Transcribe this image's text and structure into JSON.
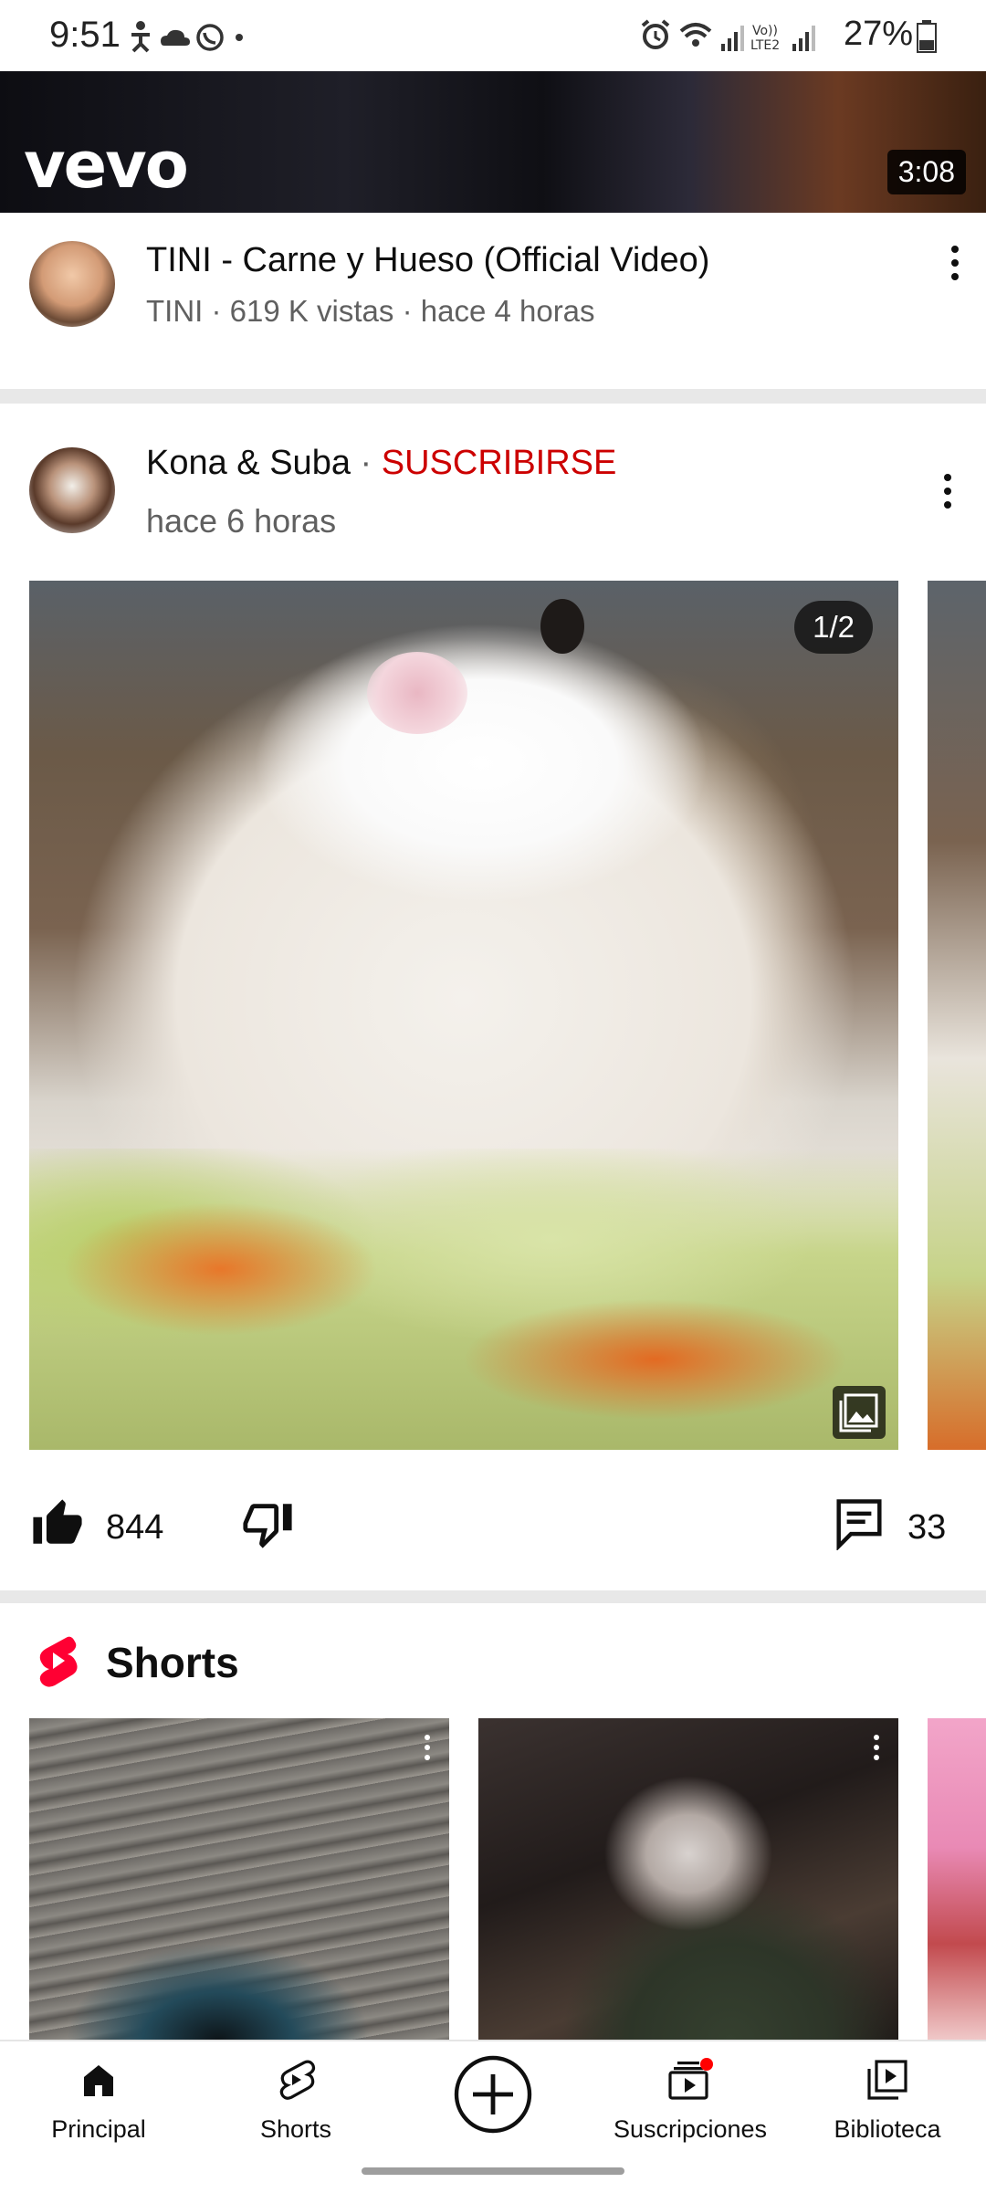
{
  "status_bar": {
    "time": "9:51",
    "battery": "27%",
    "icons": [
      "accessibility-icon",
      "cloud-icon",
      "whatsapp-icon",
      "dot-icon",
      "alarm-icon",
      "wifi-icon",
      "signal-icon",
      "volte-icon",
      "signal-icon",
      "battery-icon"
    ]
  },
  "video_card": {
    "brand": "vevo",
    "duration": "3:08",
    "title": "TINI - Carne y Hueso (Official Video)",
    "meta": "TINI · 619 K vistas · hace 4 horas"
  },
  "post": {
    "channel": "Kona & Suba",
    "separator": " · ",
    "subscribe_label": "SUSCRIBIRSE",
    "time": "hace 6 horas",
    "image_counter": "1/2",
    "likes": "844",
    "comments": "33"
  },
  "shorts": {
    "heading": "Shorts"
  },
  "nav": {
    "items": [
      {
        "label": "Principal",
        "icon": "home-icon"
      },
      {
        "label": "Shorts",
        "icon": "shorts-icon"
      },
      {
        "label": "",
        "icon": "create-icon"
      },
      {
        "label": "Suscripciones",
        "icon": "subscriptions-icon"
      },
      {
        "label": "Biblioteca",
        "icon": "library-icon"
      }
    ]
  },
  "colors": {
    "accent_red": "#cc0000",
    "shorts_red": "#ff0033",
    "text_primary": "#0f0f0f",
    "text_secondary": "#606060",
    "separator": "#e8e8e8"
  }
}
